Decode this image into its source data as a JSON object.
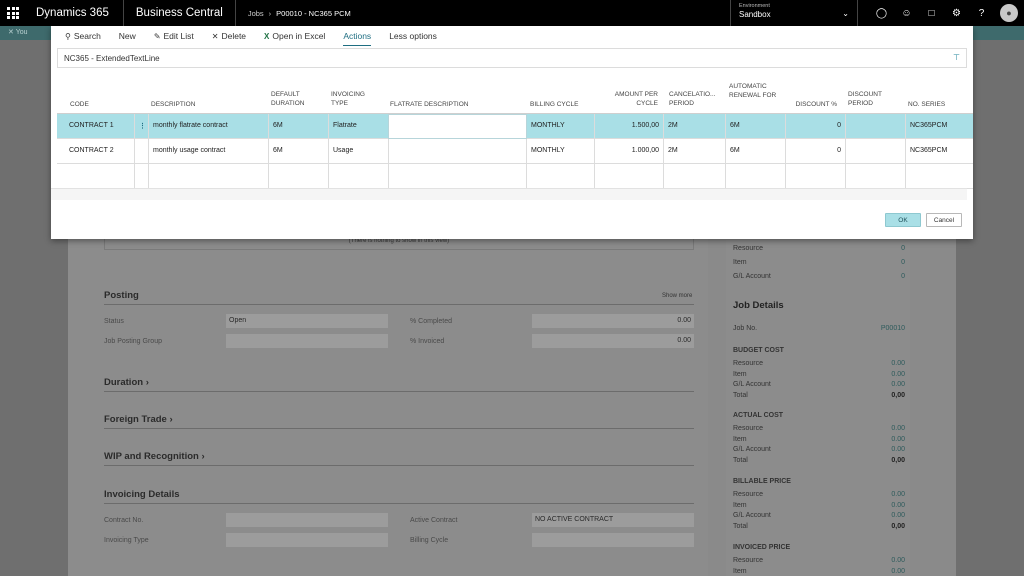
{
  "topbar": {
    "brand": "Dynamics 365",
    "app": "Business Central",
    "breadcrumb": [
      "Jobs",
      "P00010 - NC365 PCM"
    ],
    "environment_label": "Environment",
    "environment_value": "Sandbox"
  },
  "notification": "You",
  "modal": {
    "toolbar": {
      "search": "Search",
      "new": "New",
      "edit_list": "Edit List",
      "delete": "Delete",
      "open_excel": "Open in Excel",
      "actions": "Actions",
      "less_options": "Less options"
    },
    "subtitle": "NC365 - ExtendedTextLine",
    "columns": [
      "CODE",
      "DESCRIPTION",
      "DEFAULT DURATION",
      "INVOICING TYPE",
      "FLATRATE DESCRIPTION",
      "BILLING CYCLE",
      "AMOUNT PER CYCLE",
      "CANCELATIO... PERIOD",
      "AUTOMATIC RENEWAL FOR",
      "DISCOUNT %",
      "DISCOUNT PERIOD",
      "NO. SERIES"
    ],
    "rows": [
      {
        "code": "CONTRACT 1",
        "description": "monthly flatrate contract",
        "duration": "6M",
        "invoicing_type": "Flatrate",
        "flatrate_description": "",
        "billing_cycle": "MONTHLY",
        "amount": "1.500,00",
        "cancel_period": "2M",
        "renewal": "6M",
        "discount": "0",
        "discount_period": "",
        "no_series": "NC365PCM"
      },
      {
        "code": "CONTRACT 2",
        "description": "monthly usage contract",
        "duration": "6M",
        "invoicing_type": "Usage",
        "flatrate_description": "",
        "billing_cycle": "MONTHLY",
        "amount": "1.000,00",
        "cancel_period": "2M",
        "renewal": "6M",
        "discount": "0",
        "discount_period": "",
        "no_series": "NC365PCM"
      }
    ],
    "ok": "OK",
    "cancel": "Cancel"
  },
  "background": {
    "empty_text": "(There is nothing to show in this view)",
    "posting": {
      "title": "Posting",
      "show_more": "Show more",
      "status_label": "Status",
      "status_value": "Open",
      "completed_label": "% Completed",
      "completed_value": "0.00",
      "posting_group_label": "Job Posting Group",
      "posting_group_value": "",
      "invoiced_label": "% Invoiced",
      "invoiced_value": "0.00"
    },
    "duration_title": "Duration",
    "foreign_trade_title": "Foreign Trade",
    "wip_title": "WIP and Recognition",
    "invoicing": {
      "title": "Invoicing Details",
      "contract_no_label": "Contract No.",
      "active_contract_label": "Active Contract",
      "active_contract_value": "NO ACTIVE CONTRACT",
      "invoicing_type_label": "Invoicing Type",
      "billing_cycle_label": "Billing Cycle"
    },
    "factbox": {
      "top_items": [
        {
          "label": "Resource",
          "value": "0"
        },
        {
          "label": "Item",
          "value": "0"
        },
        {
          "label": "G/L Account",
          "value": "0"
        }
      ],
      "job_details_title": "Job Details",
      "job_no_label": "Job No.",
      "job_no_value": "P00010",
      "budget_cost": {
        "title": "BUDGET COST",
        "items": [
          {
            "label": "Resource",
            "value": "0.00"
          },
          {
            "label": "Item",
            "value": "0.00"
          },
          {
            "label": "G/L Account",
            "value": "0.00"
          },
          {
            "label": "Total",
            "value": "0,00"
          }
        ]
      },
      "actual_cost": {
        "title": "ACTUAL COST",
        "items": [
          {
            "label": "Resource",
            "value": "0.00"
          },
          {
            "label": "Item",
            "value": "0.00"
          },
          {
            "label": "G/L Account",
            "value": "0.00"
          },
          {
            "label": "Total",
            "value": "0,00"
          }
        ]
      },
      "billable_price": {
        "title": "BILLABLE PRICE",
        "items": [
          {
            "label": "Resource",
            "value": "0.00"
          },
          {
            "label": "Item",
            "value": "0.00"
          },
          {
            "label": "G/L Account",
            "value": "0.00"
          },
          {
            "label": "Total",
            "value": "0,00"
          }
        ]
      },
      "invoiced_price": {
        "title": "INVOICED PRICE",
        "items": [
          {
            "label": "Resource",
            "value": "0.00"
          },
          {
            "label": "Item",
            "value": "0.00"
          }
        ]
      }
    }
  }
}
